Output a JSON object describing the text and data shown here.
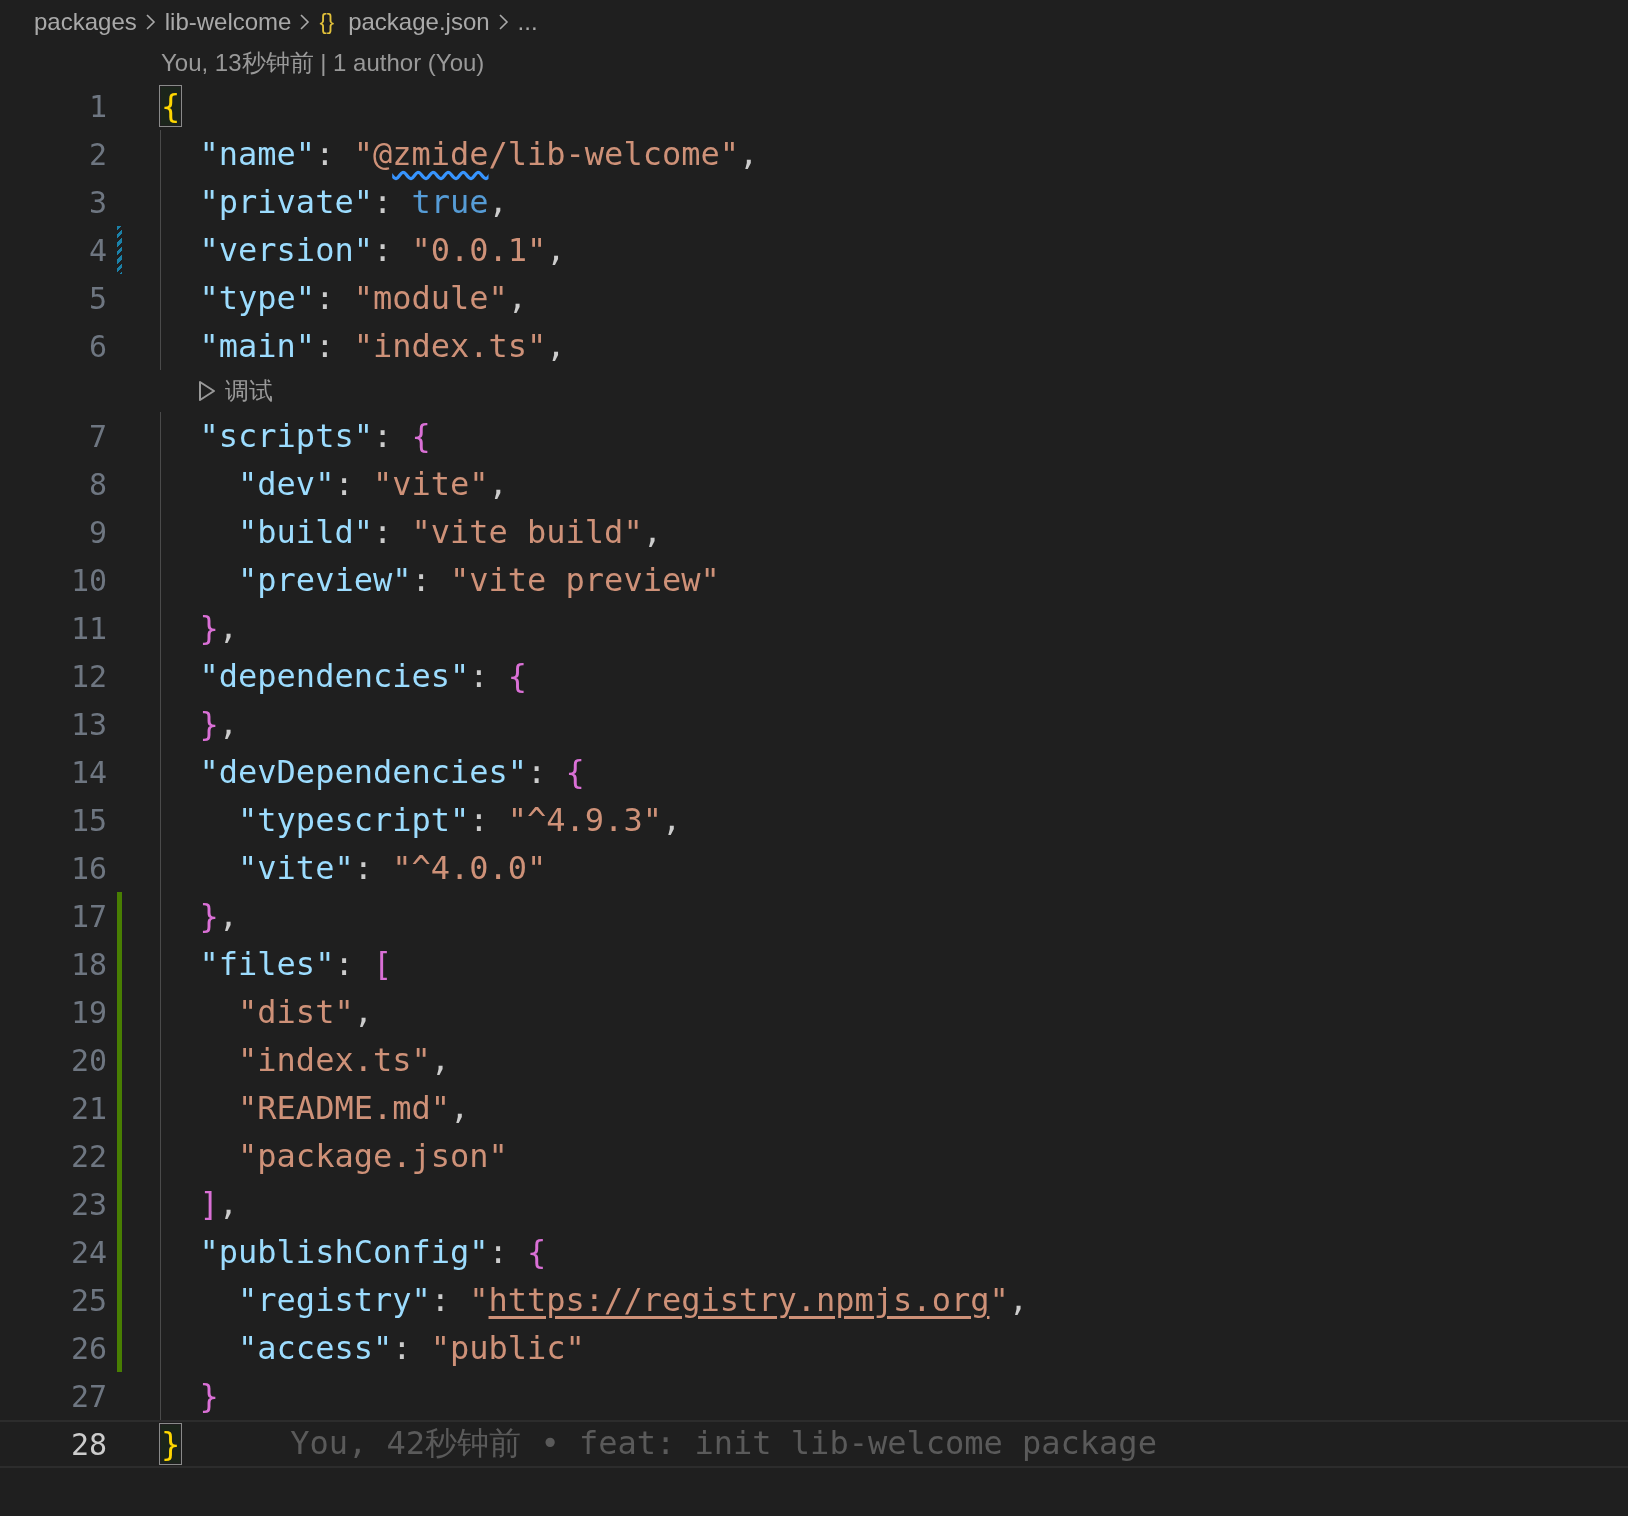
{
  "breadcrumb": [
    {
      "label": "packages"
    },
    {
      "label": "lib-welcome"
    },
    {
      "label": "package.json",
      "icon_text": "{}"
    },
    {
      "label": "..."
    }
  ],
  "codelens": "You, 13秒钟前 | 1 author (You)",
  "lines": [
    {
      "number": "1",
      "current": false,
      "added": false,
      "modified": false,
      "tokens": [
        {
          "kind": "brace-outer",
          "text": "{",
          "matched": true
        }
      ]
    },
    {
      "number": "2",
      "current": false,
      "added": false,
      "modified": false,
      "tokens": [
        {
          "kind": "key",
          "text": "  \"name\""
        },
        {
          "kind": "punct",
          "text": ": "
        },
        {
          "kind": "string",
          "text": "\"@"
        },
        {
          "kind": "string-warning",
          "text": "zmide"
        },
        {
          "kind": "string",
          "text": "/lib-welcome\""
        },
        {
          "kind": "punct",
          "text": ","
        }
      ]
    },
    {
      "number": "3",
      "current": false,
      "added": false,
      "modified": false,
      "tokens": [
        {
          "kind": "key",
          "text": "  \"private\""
        },
        {
          "kind": "punct",
          "text": ": "
        },
        {
          "kind": "keyword",
          "text": "true"
        },
        {
          "kind": "punct",
          "text": ","
        }
      ]
    },
    {
      "number": "4",
      "current": false,
      "added": false,
      "modified": true,
      "tokens": [
        {
          "kind": "key",
          "text": "  \"version\""
        },
        {
          "kind": "punct",
          "text": ": "
        },
        {
          "kind": "string",
          "text": "\"0.0.1\""
        },
        {
          "kind": "punct",
          "text": ","
        }
      ]
    },
    {
      "number": "5",
      "current": false,
      "added": false,
      "modified": false,
      "tokens": [
        {
          "kind": "key",
          "text": "  \"type\""
        },
        {
          "kind": "punct",
          "text": ": "
        },
        {
          "kind": "string",
          "text": "\"module\""
        },
        {
          "kind": "punct",
          "text": ","
        }
      ]
    },
    {
      "number": "6",
      "current": false,
      "added": false,
      "modified": false,
      "lens_after": "调试",
      "tokens": [
        {
          "kind": "key",
          "text": "  \"main\""
        },
        {
          "kind": "punct",
          "text": ": "
        },
        {
          "kind": "string",
          "text": "\"index.ts\""
        },
        {
          "kind": "punct",
          "text": ","
        }
      ]
    },
    {
      "number": "7",
      "current": false,
      "added": false,
      "modified": false,
      "tokens": [
        {
          "kind": "key",
          "text": "  \"scripts\""
        },
        {
          "kind": "punct",
          "text": ": "
        },
        {
          "kind": "brace-inner",
          "text": "{"
        }
      ]
    },
    {
      "number": "8",
      "current": false,
      "added": false,
      "modified": false,
      "tokens": [
        {
          "kind": "key",
          "text": "    \"dev\""
        },
        {
          "kind": "punct",
          "text": ": "
        },
        {
          "kind": "string",
          "text": "\"vite\""
        },
        {
          "kind": "punct",
          "text": ","
        }
      ]
    },
    {
      "number": "9",
      "current": false,
      "added": false,
      "modified": false,
      "tokens": [
        {
          "kind": "key",
          "text": "    \"build\""
        },
        {
          "kind": "punct",
          "text": ": "
        },
        {
          "kind": "string",
          "text": "\"vite build\""
        },
        {
          "kind": "punct",
          "text": ","
        }
      ]
    },
    {
      "number": "10",
      "current": false,
      "added": false,
      "modified": false,
      "tokens": [
        {
          "kind": "key",
          "text": "    \"preview\""
        },
        {
          "kind": "punct",
          "text": ": "
        },
        {
          "kind": "string",
          "text": "\"vite preview\""
        }
      ]
    },
    {
      "number": "11",
      "current": false,
      "added": false,
      "modified": false,
      "tokens": [
        {
          "kind": "brace-inner",
          "text": "  }"
        },
        {
          "kind": "punct",
          "text": ","
        }
      ]
    },
    {
      "number": "12",
      "current": false,
      "added": false,
      "modified": false,
      "tokens": [
        {
          "kind": "key",
          "text": "  \"dependencies\""
        },
        {
          "kind": "punct",
          "text": ": "
        },
        {
          "kind": "brace-inner",
          "text": "{"
        }
      ]
    },
    {
      "number": "13",
      "current": false,
      "added": false,
      "modified": false,
      "tokens": [
        {
          "kind": "brace-inner",
          "text": "  }"
        },
        {
          "kind": "punct",
          "text": ","
        }
      ]
    },
    {
      "number": "14",
      "current": false,
      "added": false,
      "modified": false,
      "tokens": [
        {
          "kind": "key",
          "text": "  \"devDependencies\""
        },
        {
          "kind": "punct",
          "text": ": "
        },
        {
          "kind": "brace-inner",
          "text": "{"
        }
      ]
    },
    {
      "number": "15",
      "current": false,
      "added": false,
      "modified": false,
      "tokens": [
        {
          "kind": "key",
          "text": "    \"typescript\""
        },
        {
          "kind": "punct",
          "text": ": "
        },
        {
          "kind": "string",
          "text": "\"^4.9.3\""
        },
        {
          "kind": "punct",
          "text": ","
        }
      ]
    },
    {
      "number": "16",
      "current": false,
      "added": false,
      "modified": false,
      "tokens": [
        {
          "kind": "key",
          "text": "    \"vite\""
        },
        {
          "kind": "punct",
          "text": ": "
        },
        {
          "kind": "string",
          "text": "\"^4.0.0\""
        }
      ]
    },
    {
      "number": "17",
      "current": false,
      "added": true,
      "modified": false,
      "tokens": [
        {
          "kind": "brace-inner",
          "text": "  }"
        },
        {
          "kind": "punct",
          "text": ","
        }
      ]
    },
    {
      "number": "18",
      "current": false,
      "added": true,
      "modified": false,
      "tokens": [
        {
          "kind": "key",
          "text": "  \"files\""
        },
        {
          "kind": "punct",
          "text": ": "
        },
        {
          "kind": "brace-inner",
          "text": "["
        }
      ]
    },
    {
      "number": "19",
      "current": false,
      "added": true,
      "modified": false,
      "tokens": [
        {
          "kind": "string",
          "text": "    \"dist\""
        },
        {
          "kind": "punct",
          "text": ","
        }
      ]
    },
    {
      "number": "20",
      "current": false,
      "added": true,
      "modified": false,
      "tokens": [
        {
          "kind": "string",
          "text": "    \"index.ts\""
        },
        {
          "kind": "punct",
          "text": ","
        }
      ]
    },
    {
      "number": "21",
      "current": false,
      "added": true,
      "modified": false,
      "tokens": [
        {
          "kind": "string",
          "text": "    \"README.md\""
        },
        {
          "kind": "punct",
          "text": ","
        }
      ]
    },
    {
      "number": "22",
      "current": false,
      "added": true,
      "modified": false,
      "tokens": [
        {
          "kind": "string",
          "text": "    \"package.json\""
        }
      ]
    },
    {
      "number": "23",
      "current": false,
      "added": true,
      "modified": false,
      "tokens": [
        {
          "kind": "brace-inner",
          "text": "  ]"
        },
        {
          "kind": "punct",
          "text": ","
        }
      ]
    },
    {
      "number": "24",
      "current": false,
      "added": true,
      "modified": false,
      "tokens": [
        {
          "kind": "key",
          "text": "  \"publishConfig\""
        },
        {
          "kind": "punct",
          "text": ": "
        },
        {
          "kind": "brace-inner",
          "text": "{"
        }
      ]
    },
    {
      "number": "25",
      "current": false,
      "added": true,
      "modified": false,
      "tokens": [
        {
          "kind": "key",
          "text": "    \"registry\""
        },
        {
          "kind": "punct",
          "text": ": "
        },
        {
          "kind": "string",
          "text": "\""
        },
        {
          "kind": "link",
          "text": "https://registry.npmjs.org"
        },
        {
          "kind": "string",
          "text": "\""
        },
        {
          "kind": "punct",
          "text": ","
        }
      ]
    },
    {
      "number": "26",
      "current": false,
      "added": true,
      "modified": false,
      "tokens": [
        {
          "kind": "key",
          "text": "    \"access\""
        },
        {
          "kind": "punct",
          "text": ": "
        },
        {
          "kind": "string",
          "text": "\"public\""
        }
      ]
    },
    {
      "number": "27",
      "current": false,
      "added": false,
      "modified": false,
      "tokens": [
        {
          "kind": "brace-inner",
          "text": "  }"
        }
      ]
    },
    {
      "number": "28",
      "current": true,
      "added": false,
      "modified": false,
      "blame": "You, 42秒钟前 • feat: init lib-welcome package",
      "tokens": [
        {
          "kind": "brace-outer",
          "text": "}",
          "matched": true
        }
      ]
    }
  ]
}
